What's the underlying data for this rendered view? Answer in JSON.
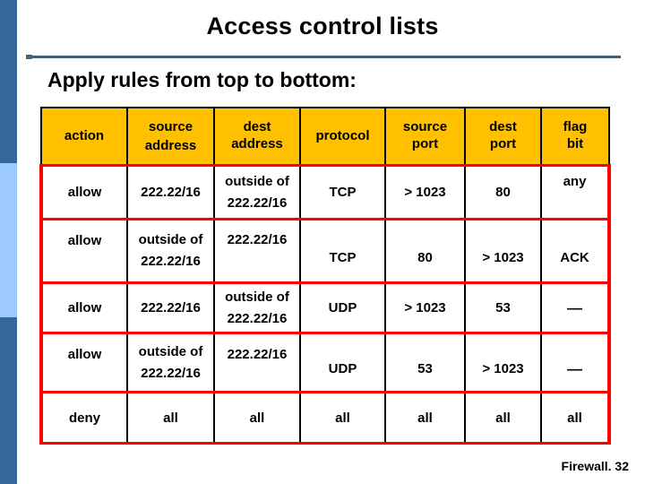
{
  "slide": {
    "title": "Access control lists",
    "subtitle": "Apply rules from top to bottom:",
    "footer": "Firewall. 32"
  },
  "colors": {
    "header_fill": "#ffc000",
    "row_border": "#ff0000",
    "cell_border": "#000000",
    "rule": "#3c6179",
    "sidebar_dark": "#35679a",
    "sidebar_light": "#9ccaff"
  },
  "table": {
    "headers": [
      {
        "line1": "action",
        "line2": ""
      },
      {
        "line1": "source",
        "line2": "address"
      },
      {
        "line1": "dest",
        "line2": "address"
      },
      {
        "line1": "protocol",
        "line2": ""
      },
      {
        "line1": "source",
        "line2": "port"
      },
      {
        "line1": "dest",
        "line2": "port"
      },
      {
        "line1": "flag",
        "line2": "bit"
      }
    ],
    "rows": [
      {
        "action": "allow",
        "source_address_l1": "222.22/16",
        "source_address_l2": "",
        "dest_address_l1": "outside of",
        "dest_address_l2": "222.22/16",
        "protocol": "TCP",
        "source_port": "> 1023",
        "dest_port": "80",
        "flag_bit": "any"
      },
      {
        "action": "allow",
        "source_address_l1": "outside of",
        "source_address_l2": "222.22/16",
        "dest_address_l1": "222.22/16",
        "dest_address_l2": "",
        "protocol": "TCP",
        "source_port": "80",
        "dest_port": "> 1023",
        "flag_bit": "ACK"
      },
      {
        "action": "allow",
        "source_address_l1": "222.22/16",
        "source_address_l2": "",
        "dest_address_l1": "outside of",
        "dest_address_l2": "222.22/16",
        "protocol": "UDP",
        "source_port": "> 1023",
        "dest_port": "53",
        "flag_bit": "—"
      },
      {
        "action": "allow",
        "source_address_l1": "outside of",
        "source_address_l2": "222.22/16",
        "dest_address_l1": "222.22/16",
        "dest_address_l2": "",
        "protocol": "UDP",
        "source_port": "53",
        "dest_port": "> 1023",
        "flag_bit": "—"
      },
      {
        "action": "deny",
        "source_address_l1": "all",
        "source_address_l2": "",
        "dest_address_l1": "all",
        "dest_address_l2": "",
        "protocol": "all",
        "source_port": "all",
        "dest_port": "all",
        "flag_bit": "all"
      }
    ]
  }
}
